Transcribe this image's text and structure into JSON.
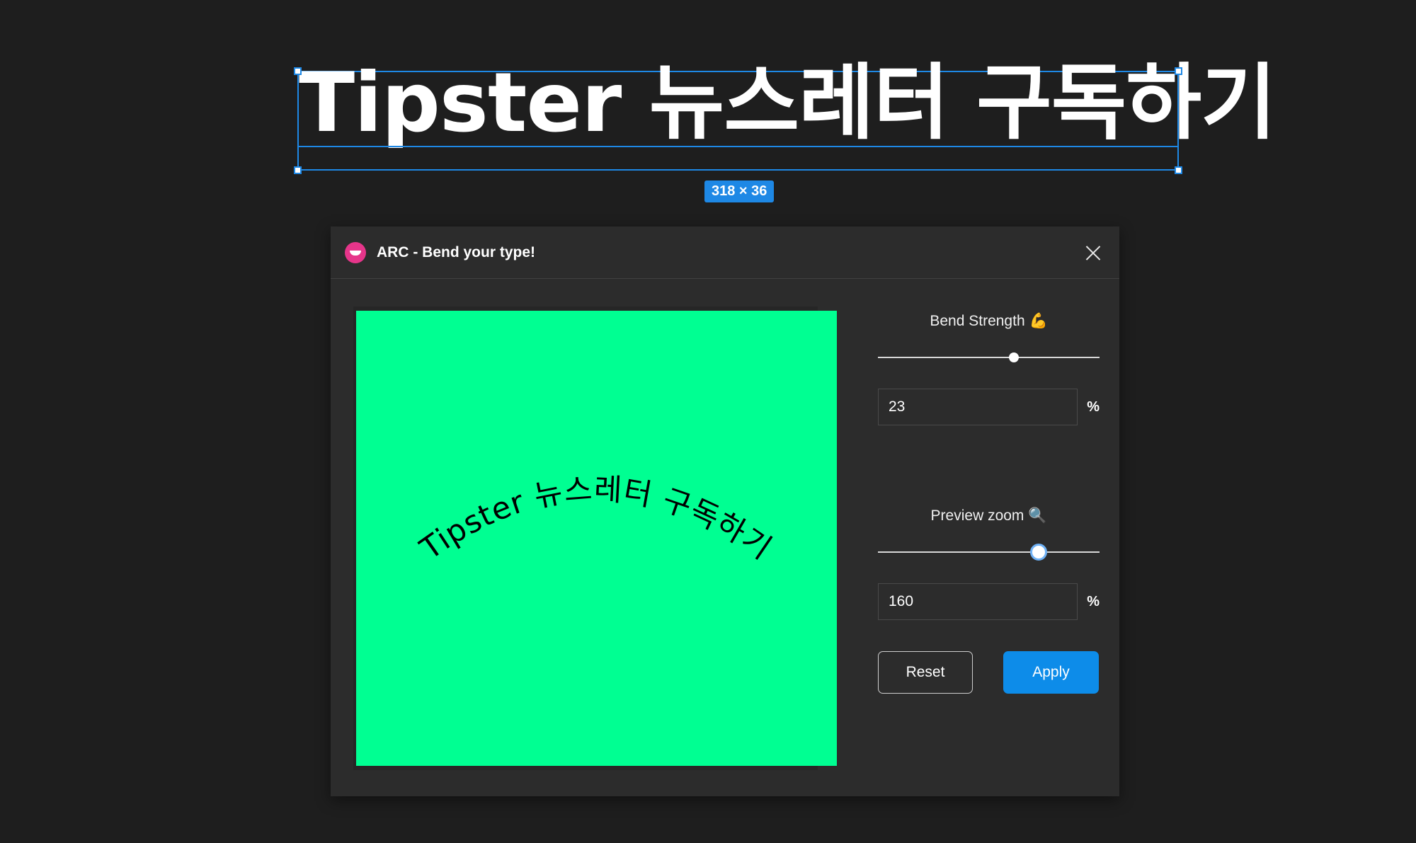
{
  "canvas": {
    "selected_text": "Tipster 뉴스레터 구독하기",
    "size_badge": "318 × 36"
  },
  "plugin": {
    "title": "ARC - Bend your type!",
    "logo_icon": "smile-icon",
    "close_icon": "close-icon",
    "preview": {
      "background_color": "#00ff92",
      "curved_text": "Tipster 뉴스레터 구독하기"
    },
    "bend_strength": {
      "label": "Bend Strength",
      "emoji": "💪",
      "value": "23",
      "unit": "%",
      "slider_fraction": 0.615
    },
    "preview_zoom": {
      "label": "Preview zoom",
      "emoji": "🔍",
      "value": "160",
      "unit": "%",
      "slider_fraction": 0.726
    },
    "buttons": {
      "reset": "Reset",
      "apply": "Apply"
    },
    "colors": {
      "accent": "#0d8ce9",
      "selection": "#1e88e5"
    }
  }
}
